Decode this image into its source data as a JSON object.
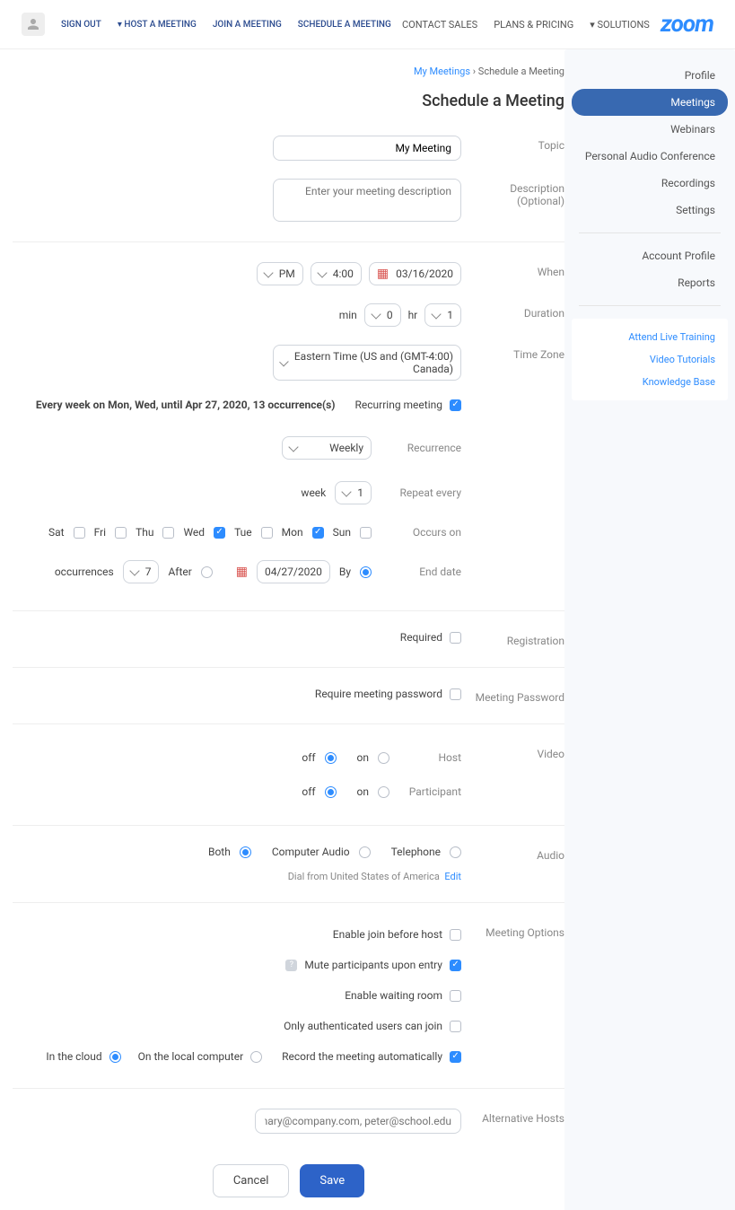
{
  "header": {
    "logo": "zoom",
    "nav": [
      "SOLUTIONS ▾",
      "PLANS & PRICING",
      "CONTACT SALES"
    ],
    "nav_right": [
      "SCHEDULE A MEETING",
      "JOIN A MEETING",
      "HOST A MEETING ▾",
      "SIGN OUT"
    ]
  },
  "sidebar": {
    "items": [
      "Profile",
      "Meetings",
      "Webinars",
      "Personal Audio Conference",
      "Recordings",
      "Settings",
      "Account Profile",
      "Reports"
    ],
    "active_index": 1,
    "links": [
      "Attend Live Training",
      "Video Tutorials",
      "Knowledge Base"
    ]
  },
  "breadcrumb": {
    "parent": "My Meetings",
    "current": "Schedule a Meeting"
  },
  "page_title": "Schedule a Meeting",
  "form": {
    "topic": {
      "label": "Topic",
      "value": "My Meeting"
    },
    "description": {
      "label": "Description (Optional)",
      "placeholder": "Enter your meeting description"
    },
    "when": {
      "label": "When",
      "date": "03/16/2020",
      "time": "4:00",
      "ampm": "PM"
    },
    "duration": {
      "label": "Duration",
      "hr": "1",
      "hr_suffix": "hr",
      "min": "0",
      "min_suffix": "min"
    },
    "timezone": {
      "label": "Time Zone",
      "value": "(GMT-4:00) Eastern Time (US and Canada)"
    },
    "recurring": {
      "checkbox_label": "Recurring meeting",
      "summary": "Every week on Mon, Wed, until Apr 27, 2020, 13 occurrence(s)"
    },
    "recurrence": {
      "label": "Recurrence",
      "value": "Weekly"
    },
    "repeat_every": {
      "label": "Repeat every",
      "value": "1",
      "unit": "week"
    },
    "occurs_on": {
      "label": "Occurs on",
      "days": [
        "Sun",
        "Mon",
        "Tue",
        "Wed",
        "Thu",
        "Fri",
        "Sat"
      ],
      "checked": [
        false,
        true,
        false,
        true,
        false,
        false,
        false
      ]
    },
    "end_date": {
      "label": "End date",
      "by": "By",
      "date": "04/27/2020",
      "after": "After",
      "count": "7",
      "suffix": "occurrences"
    },
    "registration": {
      "label": "Registration",
      "required": "Required"
    },
    "password": {
      "label": "Meeting Password",
      "text": "Require meeting password"
    },
    "video": {
      "label": "Video",
      "host": "Host",
      "participant": "Participant",
      "on": "on",
      "off": "off"
    },
    "audio": {
      "label": "Audio",
      "options": [
        "Telephone",
        "Computer Audio",
        "Both"
      ],
      "dial": "Dial from United States of America",
      "edit": "Edit"
    },
    "options": {
      "label": "Meeting Options",
      "items": [
        "Enable join before host",
        "Mute participants upon entry",
        "Enable waiting room",
        "Only authenticated users can join",
        "Record the meeting automatically"
      ],
      "checked": [
        false,
        true,
        false,
        false,
        true
      ],
      "record_local": "On the local computer",
      "record_cloud": "In the cloud"
    },
    "alt_hosts": {
      "label": "Alternative Hosts",
      "placeholder": "Example: mary@company.com, peter@school.edu"
    }
  },
  "buttons": {
    "save": "Save",
    "cancel": "Cancel"
  }
}
